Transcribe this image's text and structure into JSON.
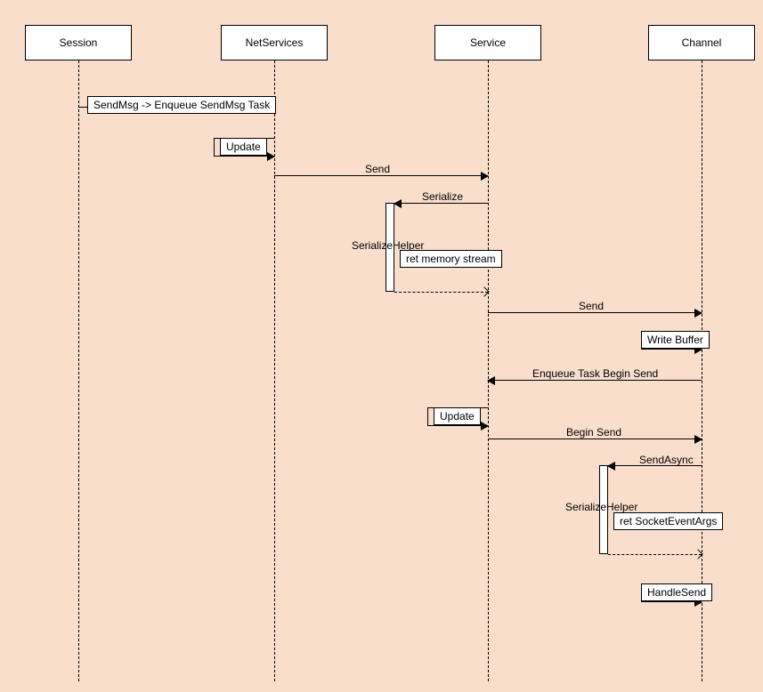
{
  "participants": {
    "session": "Session",
    "netservices": "NetServices",
    "service": "Service",
    "channel": "Channel"
  },
  "labels": {
    "sendmsg_enqueue": "SendMsg  -> Enqueue SendMsg Task",
    "update1": "Update",
    "send1": "Send",
    "serialize": "Serialize",
    "serialize_helper1": "SerializeHelper",
    "ret_memory_stream": "ret memory stream",
    "send2": "Send",
    "write_buffer": "Write Buffer",
    "enqueue_begin_send": "Enqueue Task Begin Send",
    "update2": "Update",
    "begin_send": "Begin Send",
    "send_async": "SendAsync",
    "serialize_helper2": "SerializeHelper",
    "ret_socket_event_args": "ret SocketEventArgs",
    "handle_send": "HandleSend"
  },
  "chart_data": {
    "type": "sequence_diagram",
    "participants": [
      "Session",
      "NetServices",
      "Service",
      "Channel"
    ],
    "messages": [
      {
        "from": "Session",
        "to": "NetServices",
        "label": "SendMsg -> Enqueue SendMsg Task",
        "kind": "sync"
      },
      {
        "from": "NetServices",
        "to": "NetServices",
        "label": "Update",
        "kind": "self"
      },
      {
        "from": "NetServices",
        "to": "Service",
        "label": "Send",
        "kind": "sync"
      },
      {
        "from": "Service",
        "to": "Service",
        "label": "Serialize",
        "kind": "self",
        "sublabel": "SerializeHelper"
      },
      {
        "from": "Service",
        "to": "Service",
        "label": "ret memory stream",
        "kind": "return"
      },
      {
        "from": "Service",
        "to": "Channel",
        "label": "Send",
        "kind": "sync"
      },
      {
        "from": "Channel",
        "to": "Channel",
        "label": "Write Buffer",
        "kind": "self"
      },
      {
        "from": "Channel",
        "to": "Service",
        "label": "Enqueue Task Begin Send",
        "kind": "sync"
      },
      {
        "from": "Service",
        "to": "Service",
        "label": "Update",
        "kind": "self"
      },
      {
        "from": "Service",
        "to": "Channel",
        "label": "Begin Send",
        "kind": "sync"
      },
      {
        "from": "Channel",
        "to": "Channel",
        "label": "SendAsync",
        "kind": "self",
        "sublabel": "SerializeHelper"
      },
      {
        "from": "Channel",
        "to": "Channel",
        "label": "ret SocketEventArgs",
        "kind": "return"
      },
      {
        "from": "Channel",
        "to": "Channel",
        "label": "HandleSend",
        "kind": "self"
      }
    ]
  }
}
